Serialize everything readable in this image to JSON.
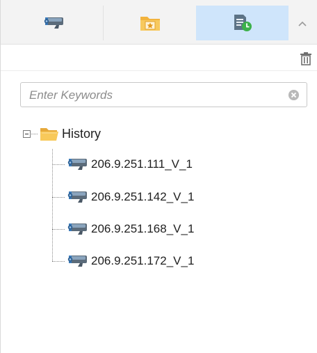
{
  "tabs": [
    {
      "icon": "camera-icon",
      "active": false
    },
    {
      "icon": "favorites-folder-icon",
      "active": false
    },
    {
      "icon": "history-clock-icon",
      "active": true
    }
  ],
  "toolbar": {
    "delete_icon": "trash-icon"
  },
  "search": {
    "placeholder": "Enter Keywords",
    "value": ""
  },
  "tree": {
    "root": {
      "label": "History",
      "expanded": true
    },
    "items": [
      {
        "label": "206.9.251.111_V_1"
      },
      {
        "label": "206.9.251.142_V_1"
      },
      {
        "label": "206.9.251.168_V_1"
      },
      {
        "label": "206.9.251.172_V_1"
      }
    ]
  },
  "colors": {
    "active_tab": "#cfe5fb",
    "folder": "#f5c04a",
    "camera": "#3a79b8",
    "history_green": "#3cb14a"
  }
}
